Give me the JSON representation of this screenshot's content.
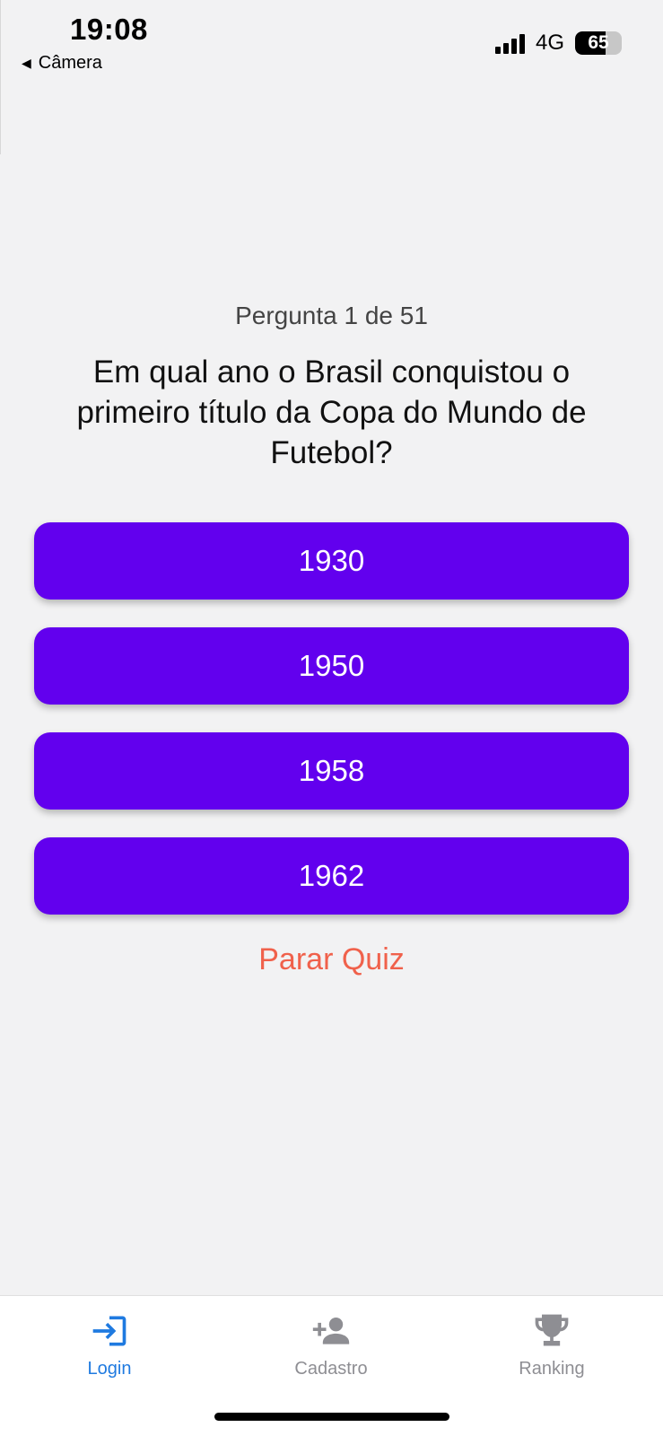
{
  "status_bar": {
    "time": "19:08",
    "back_label": "Câmera",
    "network": "4G",
    "battery": "65",
    "battery_level": 0.65
  },
  "quiz": {
    "counter": "Pergunta 1 de 51",
    "question": "Em qual ano o Brasil conquistou o primeiro título da Copa do Mundo de Futebol?",
    "answers": [
      "1930",
      "1950",
      "1958",
      "1962"
    ],
    "stop_label": "Parar Quiz"
  },
  "tabbar": {
    "items": [
      {
        "label": "Login",
        "icon": "login-icon",
        "active": true
      },
      {
        "label": "Cadastro",
        "icon": "add-person-icon",
        "active": false
      },
      {
        "label": "Ranking",
        "icon": "trophy-icon",
        "active": false
      }
    ]
  },
  "colors": {
    "background": "#f2f2f3",
    "answer_button": "#6200ee",
    "stop_text": "#f0614b",
    "tab_active": "#1f7ae0",
    "tab_inactive": "#8e8e93"
  }
}
